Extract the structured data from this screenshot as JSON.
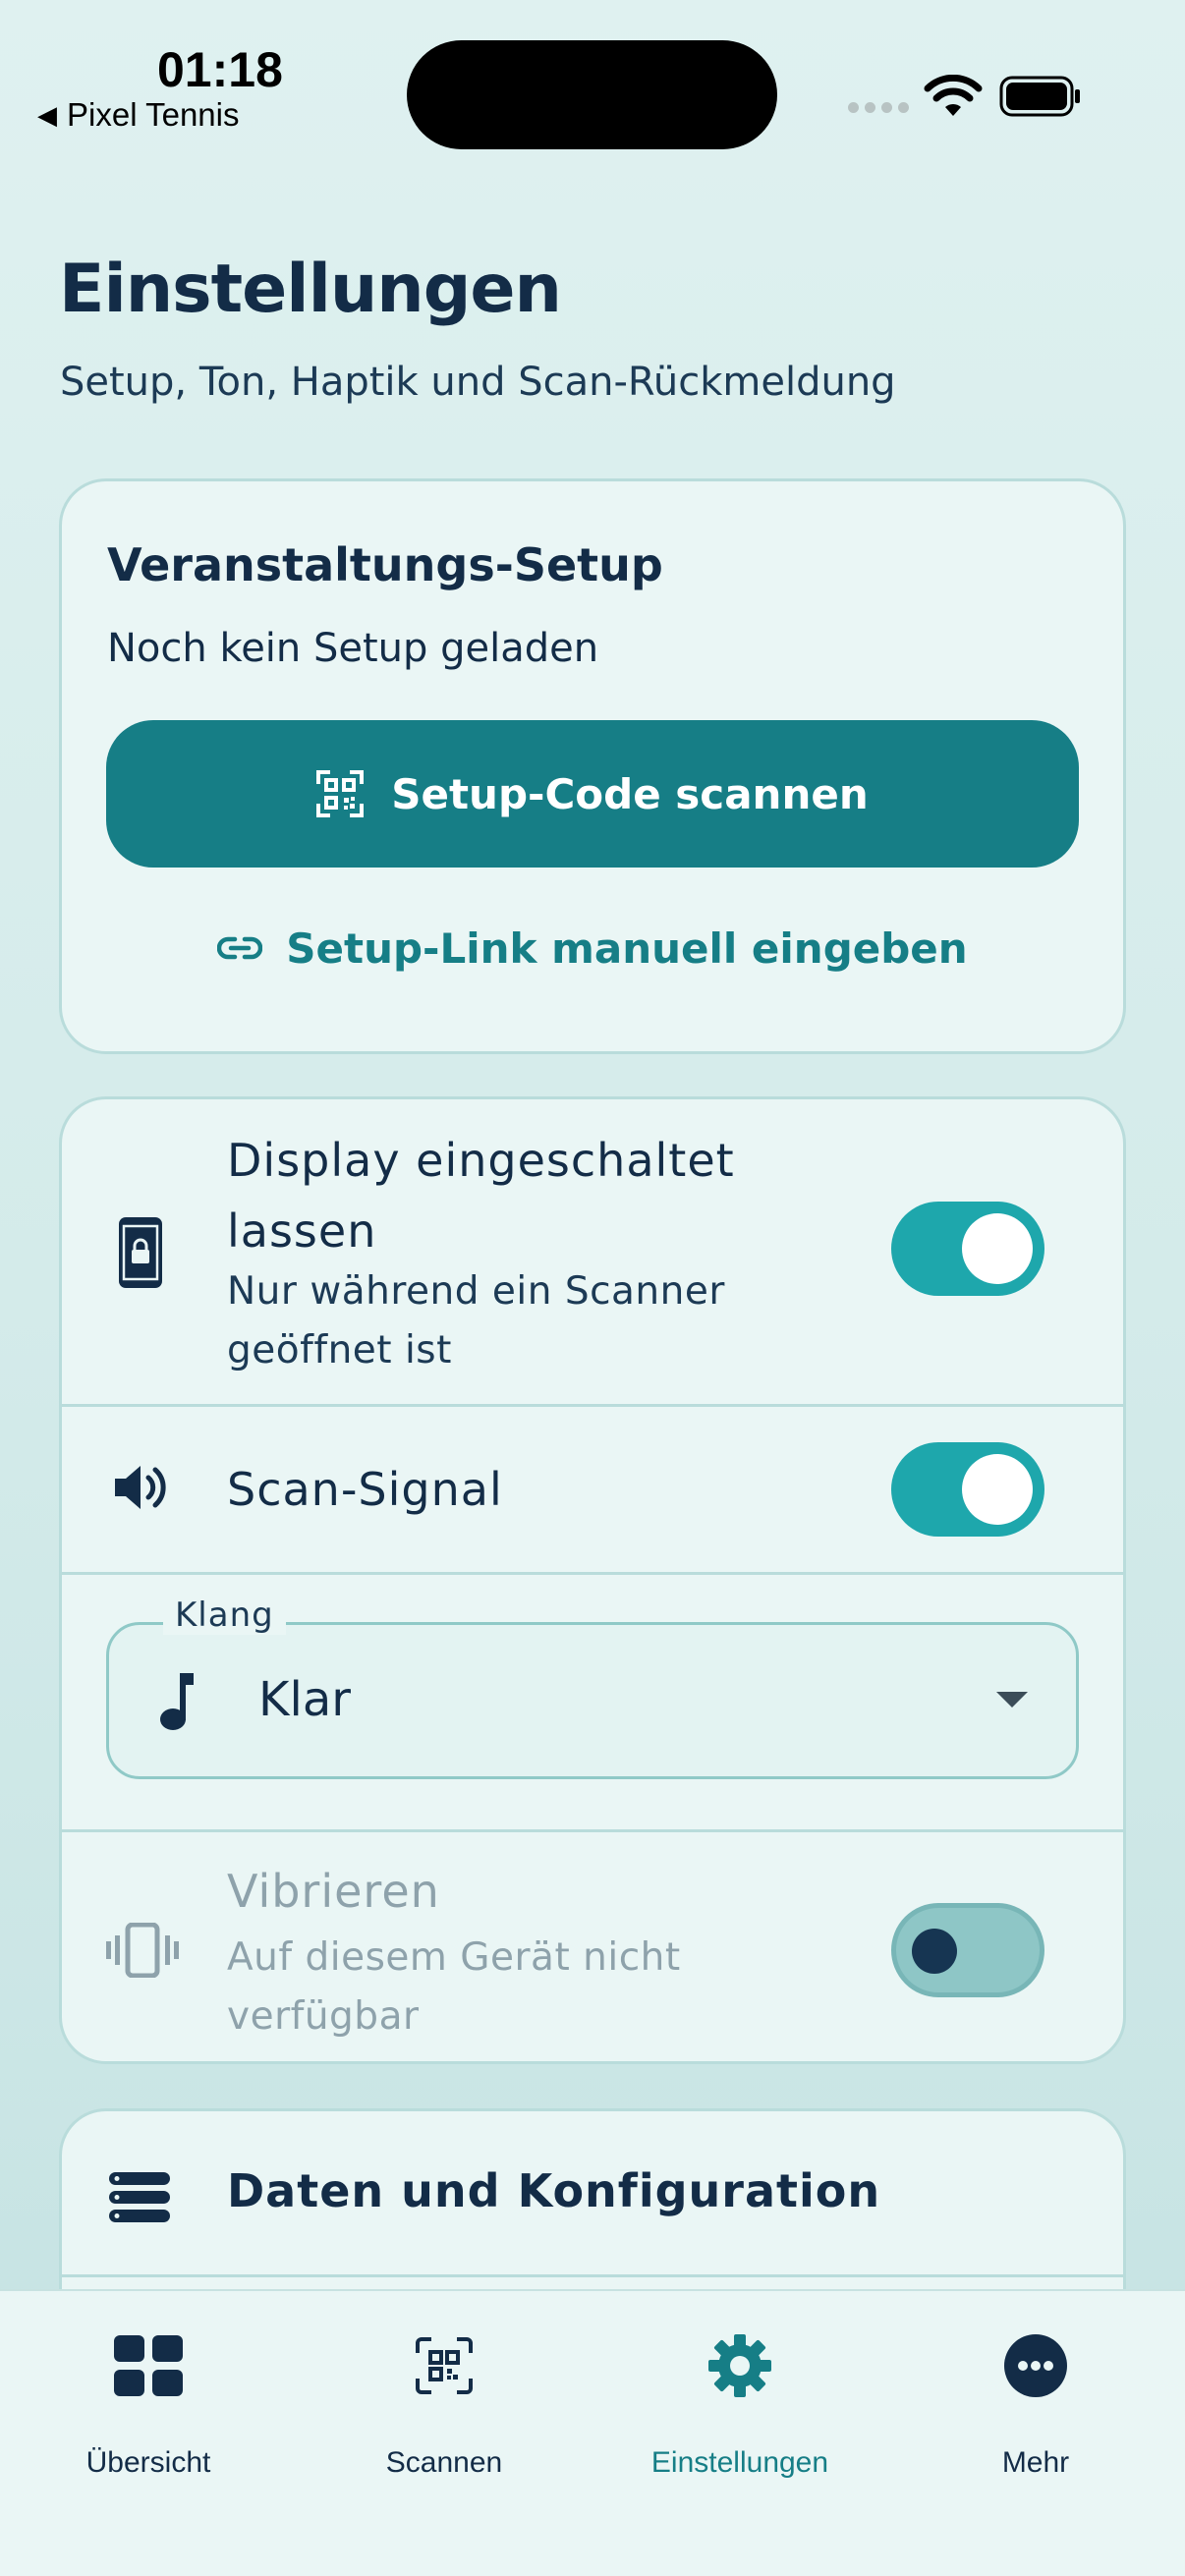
{
  "status": {
    "time": "01:18",
    "back_app": "Pixel Tennis"
  },
  "header": {
    "title": "Einstellungen",
    "subtitle": "Setup, Ton, Haptik und Scan-Rückmeldung"
  },
  "setup_card": {
    "heading": "Veranstaltungs-Setup",
    "status_text": "Noch kein Setup geladen",
    "scan_button": "Setup-Code scannen",
    "manual_link": "Setup-Link manuell eingeben"
  },
  "settings": {
    "display": {
      "title_line1": "Display eingeschaltet",
      "title_line2": "lassen",
      "sub_line1": "Nur während ein Scanner",
      "sub_line2": "geöffnet ist",
      "enabled": true
    },
    "scan_signal": {
      "title": "Scan-Signal",
      "enabled": true
    },
    "sound": {
      "label": "Klang",
      "value": "Klar"
    },
    "vibrate": {
      "title": "Vibrieren",
      "sub_line1": "Auf diesem Gerät nicht",
      "sub_line2": "verfügbar",
      "enabled": false
    }
  },
  "data_card": {
    "title": "Daten und Konfiguration"
  },
  "nav": [
    {
      "label": "Übersicht",
      "icon": "grid-icon"
    },
    {
      "label": "Scannen",
      "icon": "qr-scan-icon"
    },
    {
      "label": "Einstellungen",
      "icon": "gear-icon",
      "active": true
    },
    {
      "label": "Mehr",
      "icon": "more-icon"
    }
  ],
  "colors": {
    "accent": "#167e86",
    "toggle_on": "#1ea7ac",
    "text": "#132c47"
  }
}
